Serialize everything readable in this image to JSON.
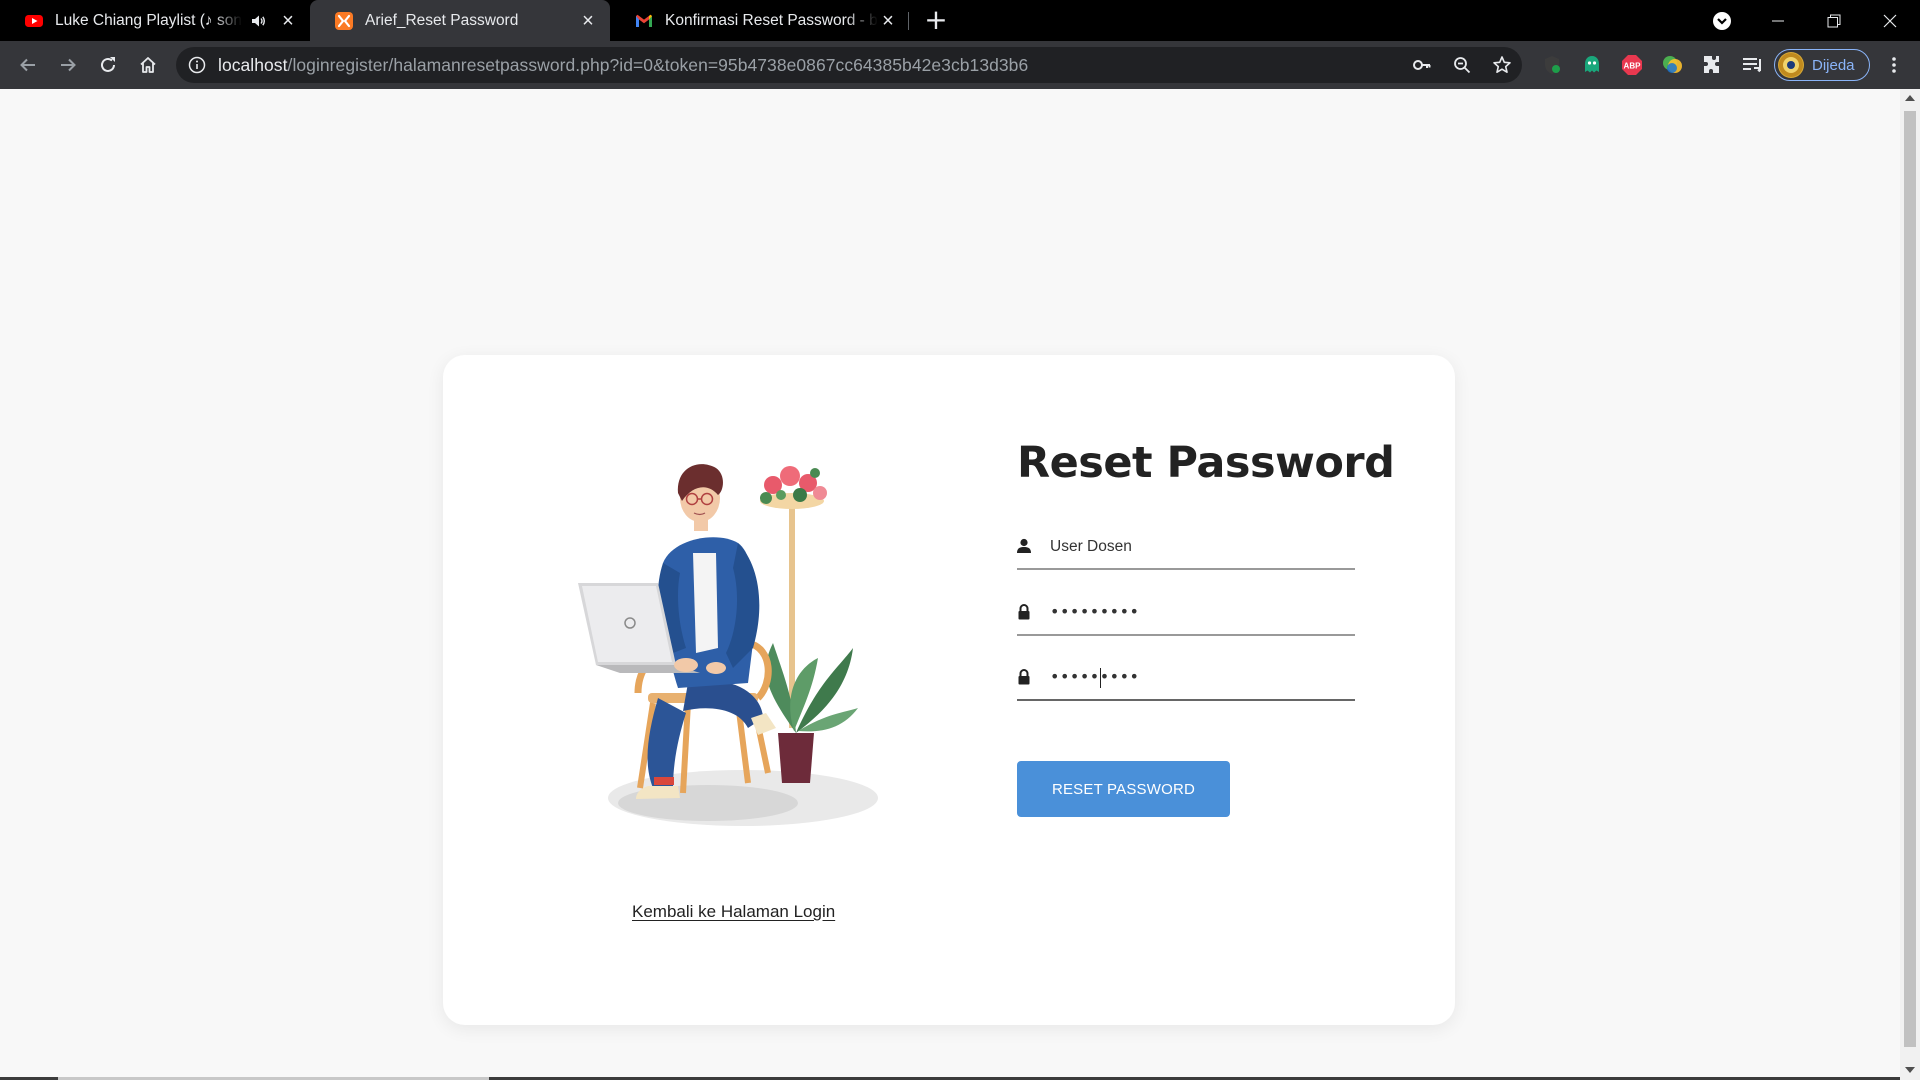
{
  "browser": {
    "tabs": [
      {
        "title": "Luke Chiang Playlist (♪ songs",
        "favicon": "youtube-icon",
        "audio": true,
        "active": false
      },
      {
        "title": "Arief_Reset Password",
        "favicon": "xampp-icon",
        "audio": false,
        "active": true
      },
      {
        "title": "Konfirmasi Reset Password - baih",
        "favicon": "gmail-icon",
        "audio": false,
        "active": false
      }
    ],
    "new_tab_label": "+",
    "url_host": "localhost",
    "url_path": "/loginregister/halamanresetpassword.php?id=0&token=95b4738e0867cc64385b42e3cb13d3b6",
    "profile_label": "Dijeda",
    "extensions": [
      "adguard-icon",
      "ghostery-icon",
      "adblock-plus-icon",
      "google-translate-icon",
      "puzzle-extensions-icon",
      "reading-list-icon"
    ],
    "accent_color": "#8ab4f8"
  },
  "page": {
    "title": "Reset Password",
    "username_field": {
      "value": "User Dosen",
      "icon": "user-icon"
    },
    "password_field": {
      "mask": "•••••••••",
      "icon": "lock-icon"
    },
    "confirm_password_field": {
      "mask": "•••••••••",
      "icon": "lock-icon"
    },
    "submit_label": "RESET PASSWORD",
    "back_link_label": "Kembali ke Halaman Login",
    "button_color": "#4a90d9",
    "illustration": "man-with-laptop-on-chair-illustration"
  }
}
